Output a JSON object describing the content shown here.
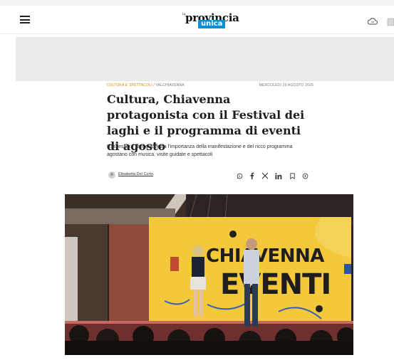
{
  "header": {
    "logo_prefix": "la",
    "logo_main": "provincia",
    "logo_sub": "unica",
    "menu_icon": "hamburger-menu-icon",
    "right_icons": [
      "weather-icon",
      "profile-icon"
    ]
  },
  "article": {
    "category": "CULTURA E SPETTACOLI",
    "separator": "/",
    "location": "VALCHIAVENNA",
    "date": "MERCOLEDÌ 20 AGOSTO 2025",
    "title": "Cultura, Chiavenna protagonista con il Festival dei laghi e il programma di eventi di agosto",
    "subtitle": "L'assessora Tam evidenzia l'importanza della manifestazione e del ricco programma agostano con musica, visite guidate e spettacoli",
    "author": "Elisabetta Del Curto",
    "share_icons": [
      "whatsapp-icon",
      "facebook-icon",
      "x-icon",
      "linkedin-icon",
      "bookmark-icon",
      "more-icon"
    ]
  },
  "photo": {
    "banner_line1": "CHIAVENNA",
    "banner_line2": "EVENTI"
  },
  "colors": {
    "category": "#d08a00",
    "logo_blue": "#0a8fd6",
    "banner_yellow": "#f3c83a"
  }
}
